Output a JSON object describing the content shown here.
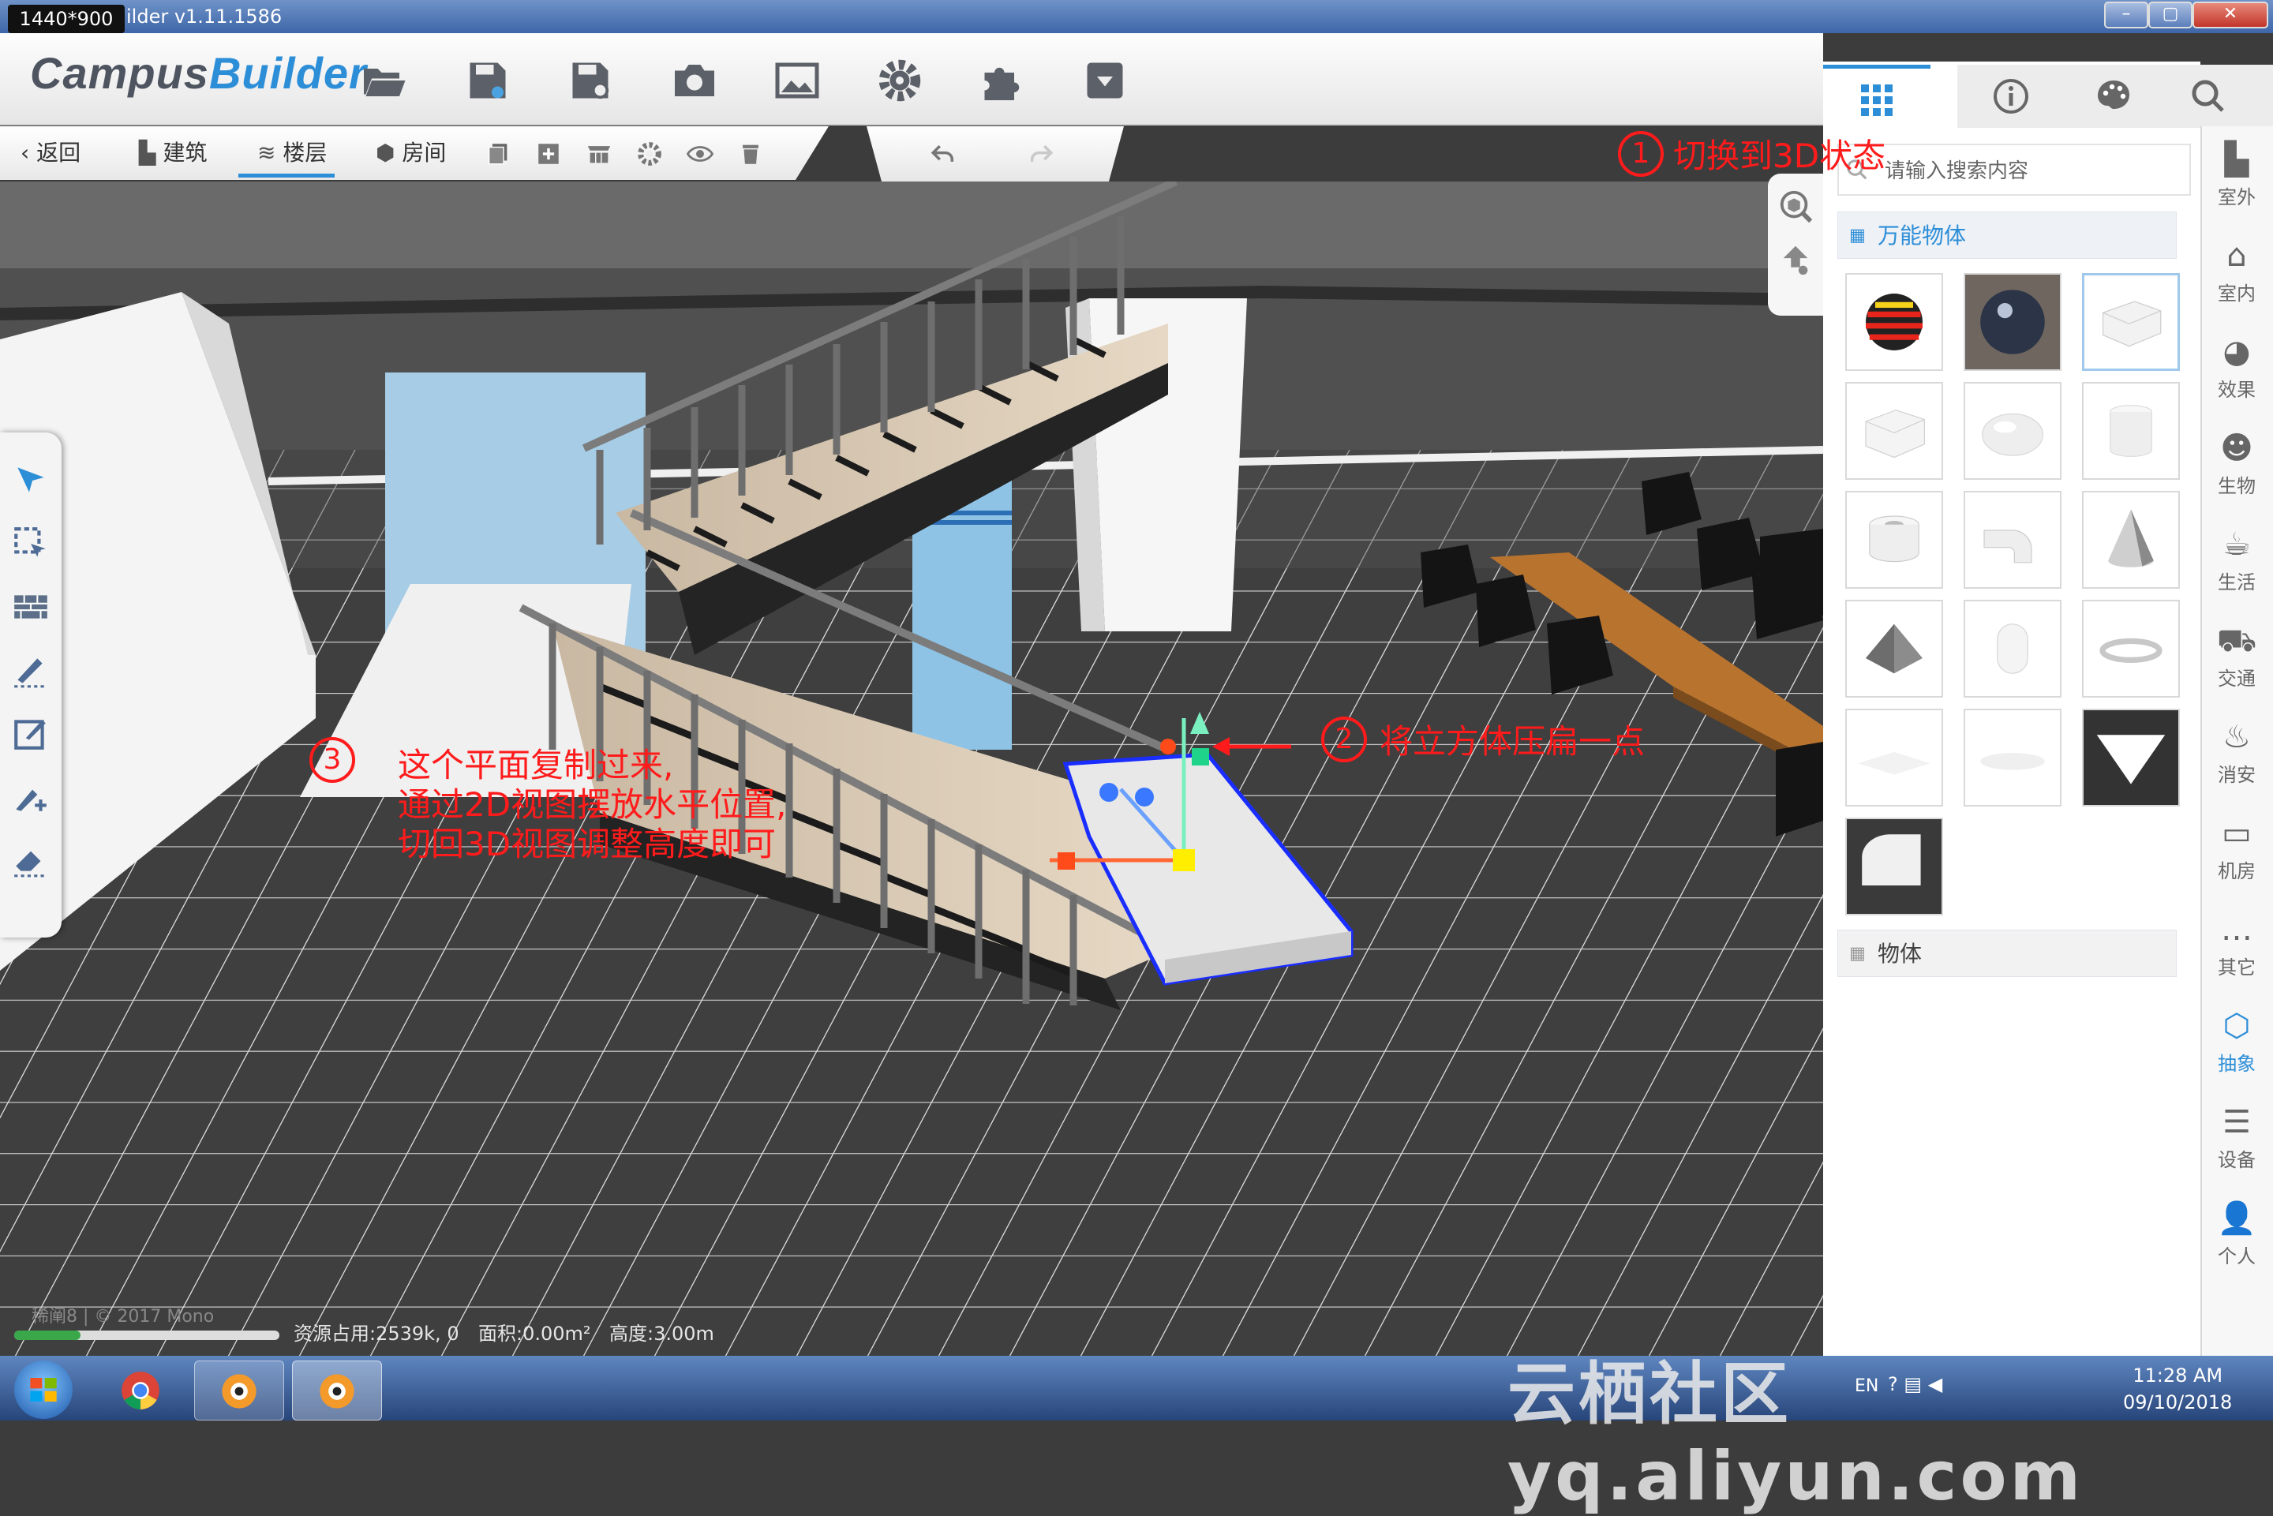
{
  "window": {
    "resolution_badge": "1440*900",
    "title": "ilder v1.11.1586",
    "buttons": [
      "minimize",
      "maximize",
      "close"
    ]
  },
  "toolbar": {
    "logo_part1": "Campus",
    "logo_part2": "Builder",
    "icons": [
      "folder-open-icon",
      "save-icon",
      "save-as-icon",
      "camera-icon",
      "image-icon",
      "gear-icon",
      "puzzle-icon",
      "download-icon"
    ]
  },
  "subbar": {
    "back": "返回",
    "building": "建筑",
    "floor": "楼层",
    "room": "房间",
    "icons": [
      "copy-icon",
      "add-icon",
      "grid-icon",
      "settings-icon",
      "eye-icon",
      "trash-icon"
    ],
    "undo": "undo-icon",
    "redo": "redo-icon"
  },
  "right_panel": {
    "tabs": [
      "grid-icon",
      "info-icon",
      "palette-icon",
      "search-icon"
    ],
    "search_placeholder": "请输入搜索内容",
    "category_open": "万能物体",
    "category_closed": "物体",
    "tiles": [
      "striped-ball",
      "dark-sphere",
      "cube-selected",
      "cube",
      "ellipsoid",
      "cylinder",
      "ring-cylinder",
      "pipe-elbow",
      "cone",
      "pyramid",
      "capsule",
      "torus",
      "plane",
      "disc",
      "triangle",
      "quarter-cylinder"
    ]
  },
  "sidebar": {
    "items": [
      {
        "label": "室外",
        "icon": "building-icon"
      },
      {
        "label": "室内",
        "icon": "home-icon"
      },
      {
        "label": "效果",
        "icon": "effect-icon"
      },
      {
        "label": "生物",
        "icon": "creature-icon"
      },
      {
        "label": "生活",
        "icon": "cup-icon"
      },
      {
        "label": "交通",
        "icon": "car-icon"
      },
      {
        "label": "消安",
        "icon": "fire-icon"
      },
      {
        "label": "机房",
        "icon": "server-icon"
      },
      {
        "label": "其它",
        "icon": "more-icon"
      },
      {
        "label": "抽象",
        "icon": "cube-icon",
        "active": true
      },
      {
        "label": "设备",
        "icon": "list-icon"
      },
      {
        "label": "个人",
        "icon": "user-icon"
      }
    ]
  },
  "status": {
    "left": "稀阐8 | © 2017 Mono",
    "resource": "资源占用:2539k, 0",
    "area": "面积:0.00m²",
    "height": "高度:3.00m",
    "progress": 0.25
  },
  "annotations": {
    "step1_num": "1",
    "step1_text": "切换到3D状态",
    "step2_num": "2",
    "step2_text": "将立方体压扁一点",
    "step3_num": "3",
    "step3_line1": "这个平面复制过来,",
    "step3_line2": "通过2D视图摆放水平位置,",
    "step3_line3": "切回3D视图调整高度即可"
  },
  "taskbar": {
    "lang": "EN",
    "time": "11:28 AM",
    "date": "09/10/2018"
  },
  "watermark": "云栖社区 yq.aliyun.com",
  "colors": {
    "accent": "#2d8ed8",
    "annotation": "#ff1b1b",
    "floor": "#3f3f3f",
    "selection": "#1a2dff"
  }
}
